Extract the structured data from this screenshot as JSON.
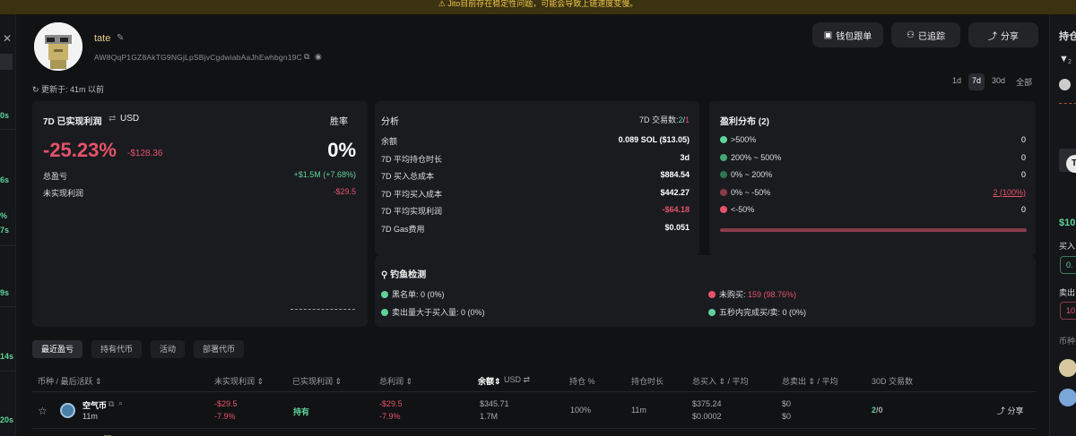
{
  "banner": {
    "text": "⚠ Jito目前存在稳定性问题，可能会导致上链速度变慢。"
  },
  "left_rail": {
    "times": [
      "0s",
      "6s",
      "7s",
      "9s",
      "14s",
      "20s"
    ],
    "pct": "%"
  },
  "right_rail": {
    "header": "持仓",
    "count": "2",
    "amount": "$10",
    "buy": "买入",
    "buy_val": "0.",
    "sell": "卖出",
    "sell_val": "10",
    "coin": "币种"
  },
  "profile": {
    "username": "tate",
    "address": "AW8QqP1GZ8AkTG9NGjLpSBjvCgdwiabAaJhEwhbgn19C",
    "updated": "更新于: 41m 以前"
  },
  "header_buttons": {
    "wallet_follow": "钱包跟单",
    "tracked": "已追踪",
    "share": "分享"
  },
  "timeframes": [
    "1d",
    "7d",
    "30d",
    "全部"
  ],
  "timeframe_active": "7d",
  "pnl_card": {
    "title": "7D 已实现利润",
    "currency": "USD",
    "winrate_label": "胜率",
    "pnl_pct": "-25.23%",
    "pnl_usd": "-$128.36",
    "winrate": "0%",
    "total_label": "总盈亏",
    "total_value": "+$1.5M (+7.68%)",
    "unrealized_label": "未实现利润",
    "unrealized_value": "-$29.5"
  },
  "analysis": {
    "title": "分析",
    "trades_label": "7D 交易数:",
    "trades_buy": "2",
    "trades_sep": "/",
    "trades_sell": "1",
    "rows": [
      {
        "label": "余额",
        "value": "0.089 SOL ($13.05)",
        "neg": false
      },
      {
        "label": "7D 平均持仓时长",
        "value": "3d",
        "neg": false
      },
      {
        "label": "7D 买入总成本",
        "value": "$884.54",
        "neg": false
      },
      {
        "label": "7D 平均买入成本",
        "value": "$442.27",
        "neg": false
      },
      {
        "label": "7D 平均实现利润",
        "value": "-$64.18",
        "neg": true
      },
      {
        "label": "7D Gas费用",
        "value": "$0.051",
        "neg": false
      }
    ]
  },
  "distribution": {
    "title": "盈利分布 (2)",
    "rows": [
      {
        "label": ">500%",
        "value": "0",
        "color": "#5ed39b",
        "underline": false
      },
      {
        "label": "200% ~ 500%",
        "value": "0",
        "color": "#43a874",
        "underline": false
      },
      {
        "label": "0% ~ 200%",
        "value": "0",
        "color": "#2e7550",
        "underline": false
      },
      {
        "label": "0% ~ -50%",
        "value": "2 (100%)",
        "color": "#8a3b4a",
        "underline": true
      },
      {
        "label": "<-50%",
        "value": "0",
        "color": "#e5536a",
        "underline": false
      }
    ],
    "bar_color": "#8a3b4a"
  },
  "phishing": {
    "title": "钓鱼检测",
    "items": [
      {
        "label": "黑名单: ",
        "value": "0 (0%)",
        "color": "#5ed39b",
        "red": false
      },
      {
        "label": "未购买: ",
        "value": "159 (98.76%)",
        "color": "#e5536a",
        "red": true
      },
      {
        "label": "卖出量大于买入量: ",
        "value": "0 (0%)",
        "color": "#5ed39b",
        "red": false
      },
      {
        "label": "五秒内完成买/卖: ",
        "value": "0 (0%)",
        "color": "#5ed39b",
        "red": false
      }
    ]
  },
  "tabs": [
    "最近盈亏",
    "持有代币",
    "活动",
    "部署代币"
  ],
  "table": {
    "headers": {
      "token": "币种 / 最后活跃 ⇕",
      "unrealized": "未实现利润 ⇕",
      "realized": "已实现利润 ⇕",
      "total": "总利润 ⇕",
      "balance": "余额⇕",
      "usd": "USD",
      "position": "持仓 %",
      "duration": "持仓时长",
      "buy": "总买入 ⇕ / 平均",
      "sell": "总卖出 ⇕ / 平均",
      "trades": "30D 交易数"
    },
    "row": {
      "name": "空气币",
      "age": "11m",
      "unrealized_usd": "-$29.5",
      "unrealized_pct": "-7.9%",
      "realized": "持有",
      "total_usd": "-$29.5",
      "total_pct": "-7.9%",
      "balance_usd": "$345.71",
      "balance_amt": "1.7M",
      "position": "100%",
      "duration": "11m",
      "buy_total": "$375.24",
      "buy_avg": "$0.0002",
      "sell_total": "$0",
      "sell_avg": "$0",
      "trades_buy": "2",
      "trades_sep": "/",
      "trades_sell": "0",
      "share": "分享"
    }
  }
}
